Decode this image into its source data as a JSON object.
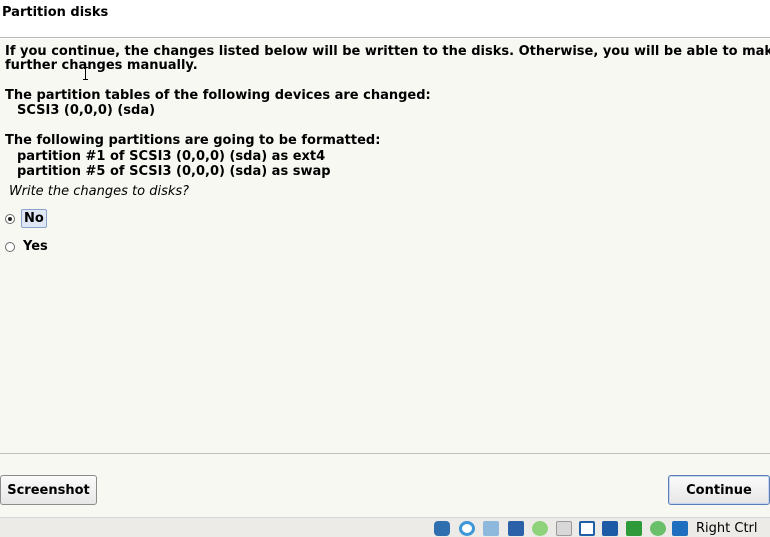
{
  "header": {
    "title": "Partition disks"
  },
  "body": {
    "intro_line1": "If you continue, the changes listed below will be written to the disks. Otherwise, you will be able to make",
    "intro_line2": "further changes manually.",
    "tables_heading": "The partition tables of the following devices are changed:",
    "tables_device": "SCSI3 (0,0,0) (sda)",
    "format_heading": "The following partitions are going to be formatted:",
    "format_items": [
      "partition #1 of SCSI3 (0,0,0) (sda) as ext4",
      "partition #5 of SCSI3 (0,0,0) (sda) as swap"
    ],
    "prompt": "Write the changes to disks?"
  },
  "options": [
    {
      "label": "No",
      "selected": true
    },
    {
      "label": "Yes",
      "selected": false
    }
  ],
  "footer": {
    "screenshot_label": "Screenshot",
    "continue_label": "Continue"
  },
  "statusbar": {
    "host_key": "Right Ctrl",
    "icons": [
      "optical-drive-icon",
      "disc-icon",
      "audio-icon",
      "network-icon",
      "usb-icon",
      "shared-folder-icon",
      "display-icon",
      "video-capture-icon",
      "cpu-icon",
      "mouse-integration-icon",
      "download-icon"
    ]
  }
}
